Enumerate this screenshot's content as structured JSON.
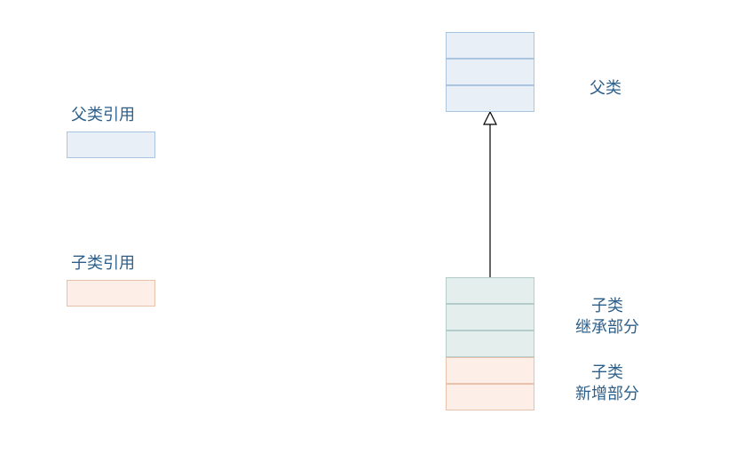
{
  "labels": {
    "parentRef": "父类引用",
    "childRef": "子类引用",
    "parentClass": "父类",
    "childInherit": "子类\n继承部分",
    "childNew": "子类\n新增部分"
  }
}
